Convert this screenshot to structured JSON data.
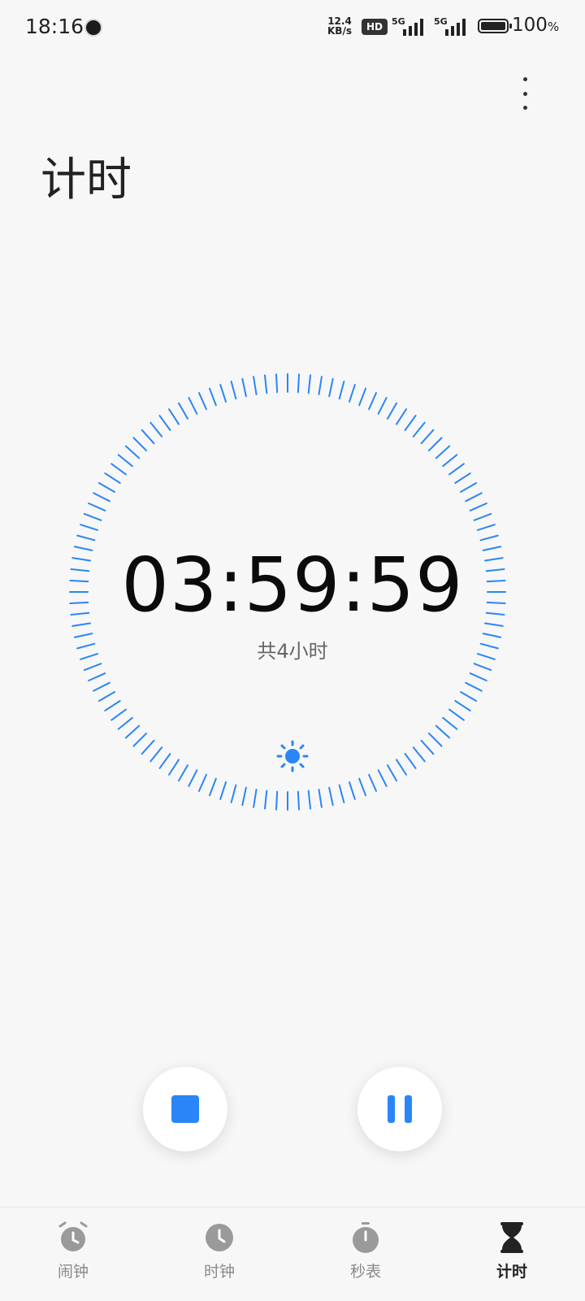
{
  "status_bar": {
    "time": "18:16",
    "net_speed": "12.4\nKB/s",
    "hd_badge": "HD",
    "network_1": "5G",
    "network_2": "5G",
    "battery_value": "100",
    "battery_unit": "%"
  },
  "header": {
    "title": "计时"
  },
  "timer": {
    "remaining": "03:59:59",
    "total_label": "共4小时",
    "accent_color": "#2a86f7"
  },
  "controls": {
    "stop": "stop-icon",
    "pause": "pause-icon"
  },
  "bottom_nav": {
    "items": [
      {
        "label": "闹钟",
        "icon": "alarm-icon",
        "active": false
      },
      {
        "label": "时钟",
        "icon": "clock-icon",
        "active": false
      },
      {
        "label": "秒表",
        "icon": "stopwatch-icon",
        "active": false
      },
      {
        "label": "计时",
        "icon": "hourglass-icon",
        "active": true
      }
    ]
  }
}
